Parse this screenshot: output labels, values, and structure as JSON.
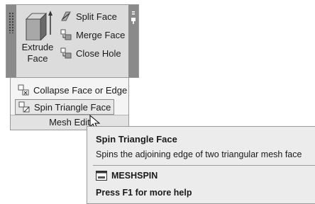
{
  "ribbon": {
    "large_button": {
      "label": "Extrude\nFace",
      "icon": "extrude-face-icon"
    },
    "small_buttons": [
      {
        "label": "Split Face",
        "icon": "split-face-icon"
      },
      {
        "label": "Merge Face",
        "icon": "merge-face-icon"
      },
      {
        "label": "Close Hole",
        "icon": "close-hole-icon"
      }
    ],
    "menu_items": [
      {
        "label": "Collapse Face or Edge",
        "icon": "collapse-face-icon"
      },
      {
        "label": "Spin Triangle Face",
        "icon": "spin-triangle-icon"
      }
    ],
    "panel_title": "Mesh Edit"
  },
  "tooltip": {
    "title": "Spin Triangle Face",
    "description": "Spins the adjoining edge of two triangular mesh face",
    "command": "MESHSPIN",
    "command_icon": "command-icon",
    "help": "Press F1 for more help"
  }
}
